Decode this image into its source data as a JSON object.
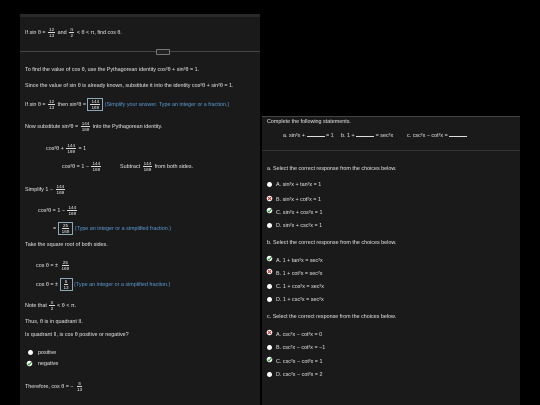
{
  "top": {
    "prefix": "If sin θ =",
    "n1": "12",
    "d1": "13",
    "and": "and",
    "n2": "π",
    "d2": "2",
    "range": "< θ < π, find cos θ."
  },
  "steps": {
    "s1": "To find the value of cos θ, use the Pythagorean identity cos²θ + sin²θ = 1.",
    "s2": "Since the value of sin θ is already known, substitute it into the identity cos²θ + sin²θ = 1.",
    "s3_prefix": "If sin θ =",
    "s3_n": "12",
    "s3_d": "13",
    "s3_mid": "then sin²θ =",
    "s3_val_n": "144",
    "s3_val_d": "169",
    "s3_hint": "(Simplify your answer. Type an integer or a fraction.)",
    "s4_prefix": "Now substitute sin²θ =",
    "s4_n": "144",
    "s4_d": "169",
    "s4_suffix": "into the Pythagorean identity.",
    "eq1_left": "cos²θ +",
    "eq1_n": "144",
    "eq1_d": "169",
    "eq1_right": "= 1",
    "eq2_left": "cos²θ = 1 −",
    "eq2_n": "144",
    "eq2_d": "169",
    "eq2_note": "Subtract",
    "eq2_note_n": "144",
    "eq2_note_d": "169",
    "eq2_note_suffix": "from both sides.",
    "simplify_prefix": "Simplify 1 −",
    "simplify_n": "144",
    "simplify_d": "169",
    "eq3_left": "cos²θ = 1 −",
    "eq3_n": "144",
    "eq3_d": "169",
    "eq4_eq": "=",
    "eq4_n": "25",
    "eq4_d": "169",
    "eq4_hint": "(Type an integer or a simplified fraction.)",
    "s5": "Take the square root of both sides.",
    "eq5_left": "cos θ = ±",
    "eq5_n": "25",
    "eq5_d": "169",
    "eq6_left": "cos θ = ±",
    "eq6_n": "5",
    "eq6_d": "13",
    "eq6_hint": "(Type an integer or a simplified fraction.)",
    "note_prefix": "Note that",
    "note_n": "π",
    "note_d": "2",
    "note_suffix": "< θ < π.",
    "quad": "Thus, θ is in quadrant II.",
    "question": "Is quadrant II, is cos θ positive or negative?",
    "opt1": "positive",
    "opt2": "negative",
    "final_prefix": "Therefore, cos θ = −",
    "final_n": "5",
    "final_d": "13"
  },
  "right": {
    "header": "Complete the following statements.",
    "statements": {
      "a": "a.  sin²x +",
      "a_end": "= 1",
      "b": "b.  1 +",
      "b_end": "= sec²x",
      "c": "c.  csc²x − cot²x ="
    },
    "sections": [
      {
        "prompt": "a. Select the correct response from the choices below.",
        "choices": [
          {
            "letter": "A.",
            "text": "sin²x + tan²x = 1",
            "state": "none"
          },
          {
            "letter": "B.",
            "text": "sin²x + cot²x = 1",
            "state": "wrong"
          },
          {
            "letter": "C.",
            "text": "sin²x + cos²x = 1",
            "state": "right"
          },
          {
            "letter": "D.",
            "text": "sin²x + csc²x = 1",
            "state": "none"
          }
        ]
      },
      {
        "prompt": "b. Select the correct response from the choices below.",
        "choices": [
          {
            "letter": "A.",
            "text": "1 + tan²x = sec²x",
            "state": "right"
          },
          {
            "letter": "B.",
            "text": "1 + cot²x = sec²x",
            "state": "wrong"
          },
          {
            "letter": "C.",
            "text": "1 + cos²x = sec²x",
            "state": "none"
          },
          {
            "letter": "D.",
            "text": "1 + csc²x = sec²x",
            "state": "none"
          }
        ]
      },
      {
        "prompt": "c. Select the correct response from the choices below.",
        "choices": [
          {
            "letter": "A.",
            "text": "csc²x − cot²x = 0",
            "state": "wrong"
          },
          {
            "letter": "B.",
            "text": "csc²x − cot²x = −1",
            "state": "none"
          },
          {
            "letter": "C.",
            "text": "csc²x − cot²x = 1",
            "state": "right"
          },
          {
            "letter": "D.",
            "text": "csc²x − cot²x = 2",
            "state": "none"
          }
        ]
      }
    ]
  },
  "colors": {
    "check_green": "#2e9e3a",
    "x_red": "#d0312d",
    "link_blue": "#5b9bd5"
  }
}
